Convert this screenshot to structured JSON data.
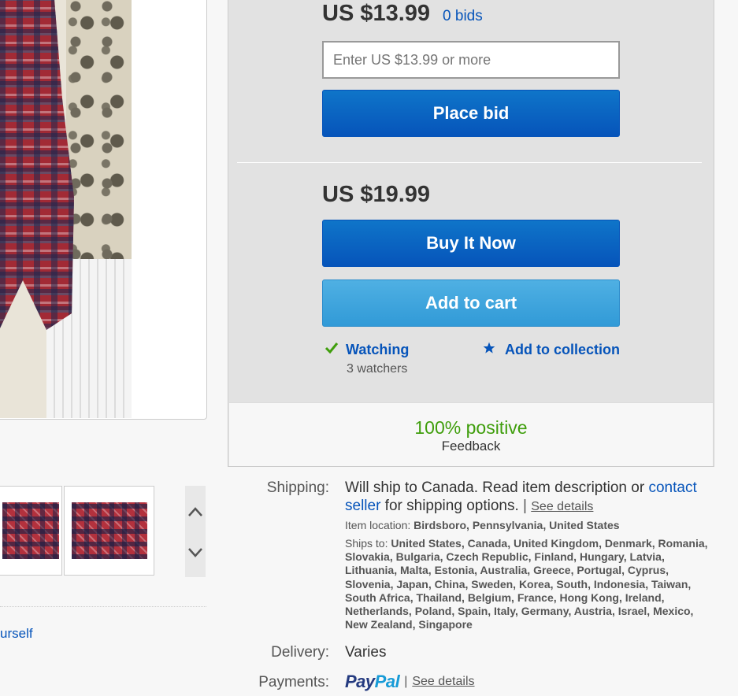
{
  "colors": {
    "link": "#0654ba",
    "button_primary": "#0654ba",
    "button_secondary": "#319ad7",
    "positive": "#3f9e0c"
  },
  "bid": {
    "current_price": "US $13.99",
    "bids_link": "0 bids",
    "input_placeholder": "Enter US $13.99 or more",
    "place_bid_label": "Place bid"
  },
  "buy_now": {
    "price": "US $19.99",
    "buy_it_now_label": "Buy It Now",
    "add_to_cart_label": "Add to cart"
  },
  "watch": {
    "watching_label": "Watching",
    "watchers": "3 watchers",
    "add_to_collection_label": "Add to collection",
    "watching_icon": "check-icon",
    "collection_icon": "star-icon"
  },
  "seller": {
    "feedback_percent": "100% positive",
    "feedback_label": "Feedback"
  },
  "thumbnails": {
    "nav_up_icon": "chevron-up-icon",
    "nav_down_icon": "chevron-down-icon"
  },
  "left_link": "urself",
  "shipping": {
    "label": "Shipping:",
    "text_part1": "Will ship to Canada. Read item description or ",
    "contact_link": "contact seller",
    "text_part2": " for shipping options.",
    "separator": "|",
    "see_details": "See details",
    "item_location_label": "Item location:",
    "item_location": "Birdsboro, Pennsylvania, United States",
    "ships_to_label": "Ships to:",
    "ships_to": "United States, Canada, United Kingdom, Denmark, Romania, Slovakia, Bulgaria, Czech Republic, Finland, Hungary, Latvia, Lithuania, Malta, Estonia, Australia, Greece, Portugal, Cyprus, Slovenia, Japan, China, Sweden, Korea, South, Indonesia, Taiwan, South Africa, Thailand, Belgium, France, Hong Kong, Ireland, Netherlands, Poland, Spain, Italy, Germany, Austria, Israel, Mexico, New Zealand, Singapore"
  },
  "delivery": {
    "label": "Delivery:",
    "value": "Varies"
  },
  "payments": {
    "label": "Payments:",
    "paypal_pay": "Pay",
    "paypal_pal": "Pal",
    "separator": "|",
    "see_details": "See details"
  }
}
